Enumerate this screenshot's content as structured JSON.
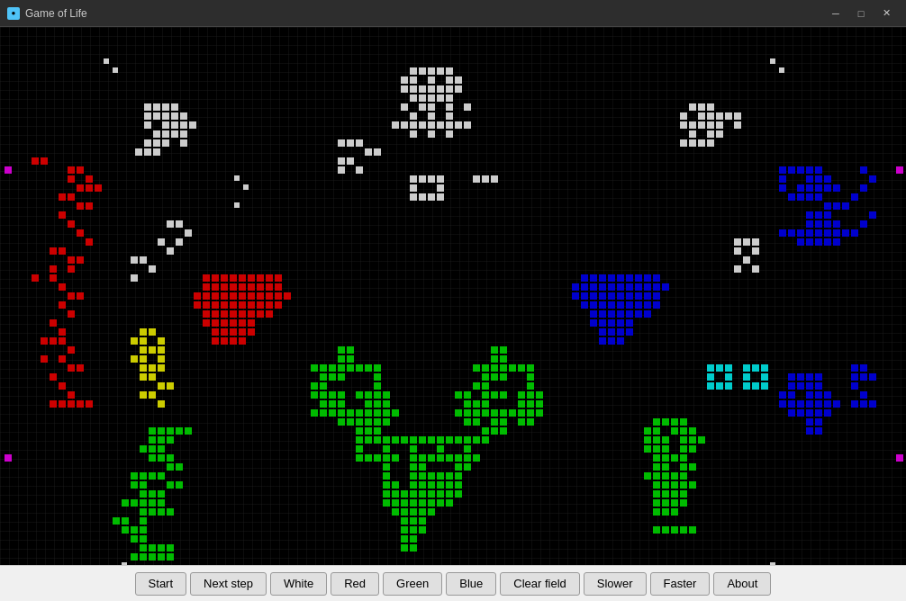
{
  "titleBar": {
    "title": "Game of Life",
    "minimizeLabel": "─",
    "maximizeLabel": "□",
    "closeLabel": "✕"
  },
  "toolbar": {
    "buttons": [
      {
        "id": "start",
        "label": "Start"
      },
      {
        "id": "next-step",
        "label": "Next step"
      },
      {
        "id": "white",
        "label": "White"
      },
      {
        "id": "red",
        "label": "Red"
      },
      {
        "id": "green",
        "label": "Green"
      },
      {
        "id": "blue",
        "label": "Blue"
      },
      {
        "id": "clear-field",
        "label": "Clear field"
      },
      {
        "id": "slower",
        "label": "Slower"
      },
      {
        "id": "faster",
        "label": "Faster"
      },
      {
        "id": "about",
        "label": "About"
      }
    ]
  },
  "colors": {
    "white": "#ffffff",
    "red": "#cc0000",
    "green": "#00bb00",
    "blue": "#0000cc",
    "yellow": "#cccc00",
    "cyan": "#00cccc",
    "magenta": "#cc00cc"
  }
}
